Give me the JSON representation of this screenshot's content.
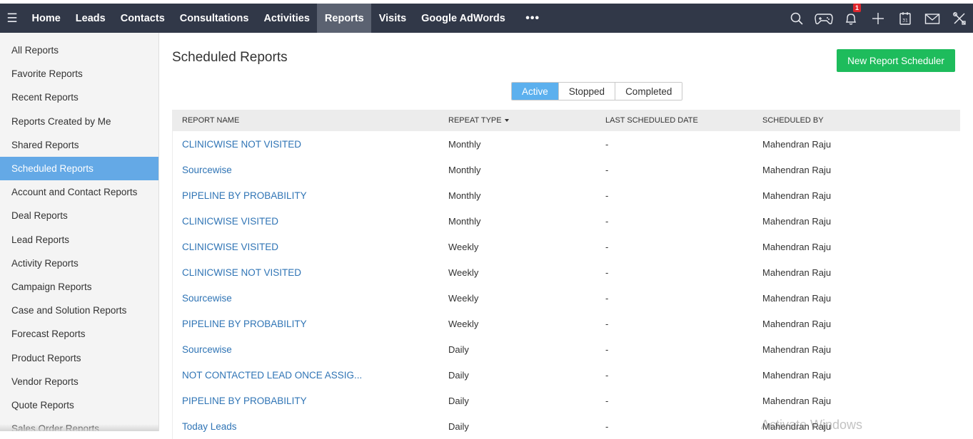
{
  "nav": {
    "items": [
      {
        "label": "Home",
        "active": false
      },
      {
        "label": "Leads",
        "active": false
      },
      {
        "label": "Contacts",
        "active": false
      },
      {
        "label": "Consultations",
        "active": false
      },
      {
        "label": "Activities",
        "active": false
      },
      {
        "label": "Reports",
        "active": true
      },
      {
        "label": "Visits",
        "active": false
      },
      {
        "label": "Google AdWords",
        "active": false
      }
    ],
    "more_label": "•••",
    "notification_count": "1",
    "icons": [
      "search-icon",
      "gamepad-icon",
      "bell-icon",
      "plus-icon",
      "calendar-icon",
      "mail-icon",
      "tools-icon"
    ]
  },
  "sidebar": {
    "items": [
      {
        "label": "All Reports",
        "active": false
      },
      {
        "label": "Favorite Reports",
        "active": false
      },
      {
        "label": "Recent Reports",
        "active": false
      },
      {
        "label": "Reports Created by Me",
        "active": false
      },
      {
        "label": "Shared Reports",
        "active": false
      },
      {
        "label": "Scheduled Reports",
        "active": true
      },
      {
        "label": "Account and Contact Reports",
        "active": false
      },
      {
        "label": "Deal Reports",
        "active": false
      },
      {
        "label": "Lead Reports",
        "active": false
      },
      {
        "label": "Activity Reports",
        "active": false
      },
      {
        "label": "Campaign Reports",
        "active": false
      },
      {
        "label": "Case and Solution Reports",
        "active": false
      },
      {
        "label": "Forecast Reports",
        "active": false
      },
      {
        "label": "Product Reports",
        "active": false
      },
      {
        "label": "Vendor Reports",
        "active": false
      },
      {
        "label": "Quote Reports",
        "active": false
      },
      {
        "label": "Sales Order Reports",
        "active": false
      }
    ]
  },
  "main": {
    "title": "Scheduled Reports",
    "new_button_label": "New Report Scheduler",
    "tabs": [
      {
        "label": "Active",
        "active": true
      },
      {
        "label": "Stopped",
        "active": false
      },
      {
        "label": "Completed",
        "active": false
      }
    ],
    "table": {
      "columns": [
        "REPORT NAME",
        "REPEAT TYPE",
        "LAST SCHEDULED DATE",
        "SCHEDULED BY"
      ],
      "rows": [
        [
          "CLINICWISE NOT VISITED",
          "Monthly",
          "-",
          "Mahendran Raju"
        ],
        [
          "Sourcewise",
          "Monthly",
          "-",
          "Mahendran Raju"
        ],
        [
          "PIPELINE BY PROBABILITY",
          "Monthly",
          "-",
          "Mahendran Raju"
        ],
        [
          "CLINICWISE VISITED",
          "Monthly",
          "-",
          "Mahendran Raju"
        ],
        [
          "CLINICWISE VISITED",
          "Weekly",
          "-",
          "Mahendran Raju"
        ],
        [
          "CLINICWISE NOT VISITED",
          "Weekly",
          "-",
          "Mahendran Raju"
        ],
        [
          "Sourcewise",
          "Weekly",
          "-",
          "Mahendran Raju"
        ],
        [
          "PIPELINE BY PROBABILITY",
          "Weekly",
          "-",
          "Mahendran Raju"
        ],
        [
          "Sourcewise",
          "Daily",
          "-",
          "Mahendran Raju"
        ],
        [
          "NOT CONTACTED LEAD ONCE ASSIG...",
          "Daily",
          "-",
          "Mahendran Raju"
        ],
        [
          "PIPELINE BY PROBABILITY",
          "Daily",
          "-",
          "Mahendran Raju"
        ],
        [
          "Today Leads",
          "Daily",
          "-",
          "Mahendran Raju"
        ]
      ]
    }
  },
  "watermark": "Activate Windows",
  "colors": {
    "topbar": "#313848",
    "nav_active": "#5b6271",
    "sidebar_active": "#64a9e6",
    "primary_button": "#1ebc5c",
    "tab_active": "#5cb0ee",
    "link": "#2f74b5"
  }
}
